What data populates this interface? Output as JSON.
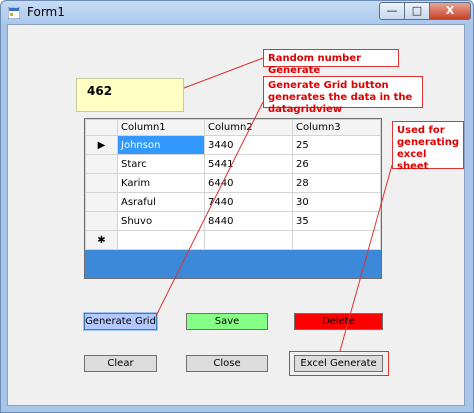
{
  "window": {
    "title": "Form1",
    "minimize_glyph": "—",
    "maximize_glyph": "□",
    "close_glyph": "X"
  },
  "random_value": "462",
  "callouts": {
    "random": "Random number  Generate",
    "grid": "Generate Grid button generates the data in the datagridview",
    "excel": "Used for generating excel sheet"
  },
  "grid": {
    "columns": [
      "Column1",
      "Column2",
      "Column3"
    ],
    "rows": [
      [
        "Johnson",
        "3440",
        "25"
      ],
      [
        "Starc",
        "5441",
        "26"
      ],
      [
        "Karim",
        "6440",
        "28"
      ],
      [
        "Asraful",
        "7440",
        "30"
      ],
      [
        "Shuvo",
        "8440",
        "35"
      ]
    ],
    "current_row_glyph": "▶",
    "new_row_glyph": "✱"
  },
  "buttons": {
    "generate_grid": "Generate Grid",
    "save": "Save",
    "delete": "Delete",
    "clear": "Clear",
    "close": "Close",
    "excel_generate": "Excel Generate"
  },
  "colors": {
    "grid_background": "#3d89d9",
    "save": "#85ff85",
    "delete": "#ff0000",
    "generate_grid": "#b4c8ff",
    "random_box": "#ffffc4",
    "callout_text": "#d00000"
  },
  "icons": [
    "app-icon",
    "minimize-icon",
    "maximize-icon",
    "close-icon",
    "current-row-icon",
    "new-row-icon"
  ]
}
